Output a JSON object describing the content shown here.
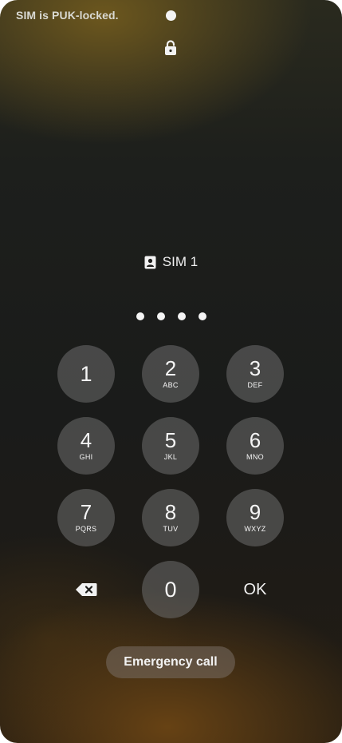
{
  "status": {
    "sim_status_text": "SIM is PUK-locked."
  },
  "sim": {
    "label": "SIM 1"
  },
  "pin_entry": {
    "entered_count": 4
  },
  "keypad": {
    "keys": [
      {
        "digit": "1",
        "letters": ""
      },
      {
        "digit": "2",
        "letters": "ABC"
      },
      {
        "digit": "3",
        "letters": "DEF"
      },
      {
        "digit": "4",
        "letters": "GHI"
      },
      {
        "digit": "5",
        "letters": "JKL"
      },
      {
        "digit": "6",
        "letters": "MNO"
      },
      {
        "digit": "7",
        "letters": "PQRS"
      },
      {
        "digit": "8",
        "letters": "TUV"
      },
      {
        "digit": "9",
        "letters": "WXYZ"
      },
      {
        "digit": "0",
        "letters": ""
      }
    ],
    "ok_label": "OK",
    "backspace_icon": "backspace-icon"
  },
  "emergency": {
    "label": "Emergency call"
  },
  "icons": {
    "lock": "lock-icon",
    "sim": "sim-card-icon"
  },
  "colors": {
    "key_fill": "#6e6e6e",
    "text": "#f2f2f2"
  }
}
